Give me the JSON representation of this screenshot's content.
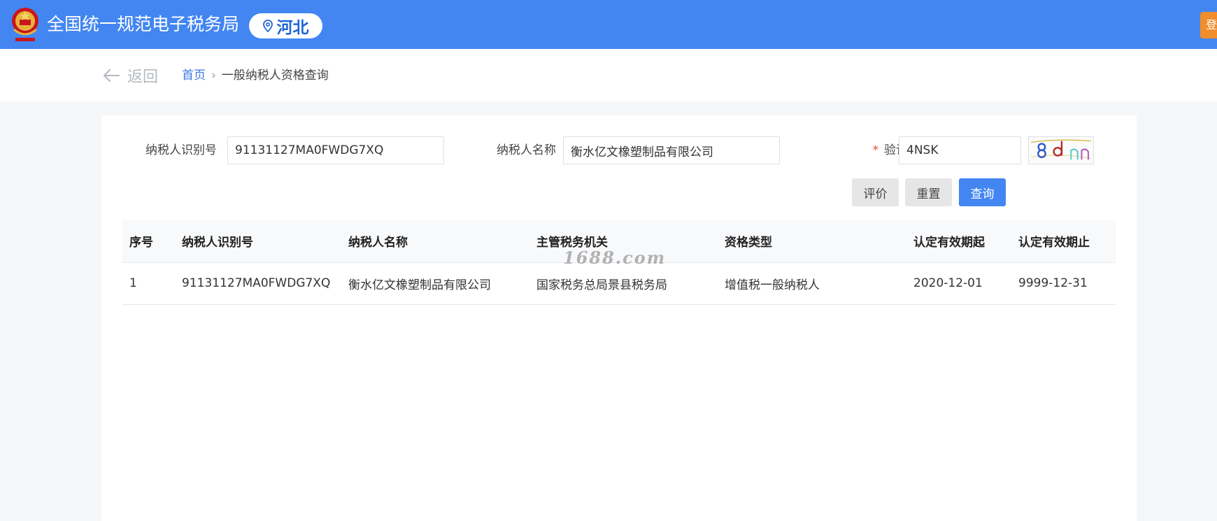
{
  "header": {
    "site_title": "全国统一规范电子税务局",
    "region": "河北",
    "login_label": "登"
  },
  "nav": {
    "back_label": "返回",
    "breadcrumb_home": "首页",
    "breadcrumb_separator": "›",
    "breadcrumb_current": "一般纳税人资格查询"
  },
  "form": {
    "taxpayer_id_label": "纳税人识别号",
    "taxpayer_id_value": "91131127MA0FWDG7XQ",
    "taxpayer_name_label": "纳税人名称",
    "taxpayer_name_value": "衡水亿文橡塑制品有限公司",
    "captcha_label": "验证码",
    "captcha_required_mark": "*",
    "captcha_value": "4NSK"
  },
  "buttons": {
    "evaluate": "评价",
    "reset": "重置",
    "query": "查询"
  },
  "table": {
    "columns": [
      "序号",
      "纳税人识别号",
      "纳税人名称",
      "主管税务机关",
      "资格类型",
      "认定有效期起",
      "认定有效期止"
    ],
    "rows": [
      [
        "1",
        "91131127MA0FWDG7XQ",
        "衡水亿文橡塑制品有限公司",
        "国家税务总局景县税务局",
        "增值税一般纳税人",
        "2020-12-01",
        "9999-12-31"
      ]
    ]
  },
  "watermark": "1688.com",
  "colors": {
    "header_blue": "#4386f2",
    "link_blue": "#3a78e4",
    "required_red": "#e64b3b",
    "login_orange": "#f08d2c"
  },
  "icons": {
    "emblem": "national-tax-emblem-icon",
    "location": "location-pin-icon",
    "back": "arrow-left-icon"
  }
}
